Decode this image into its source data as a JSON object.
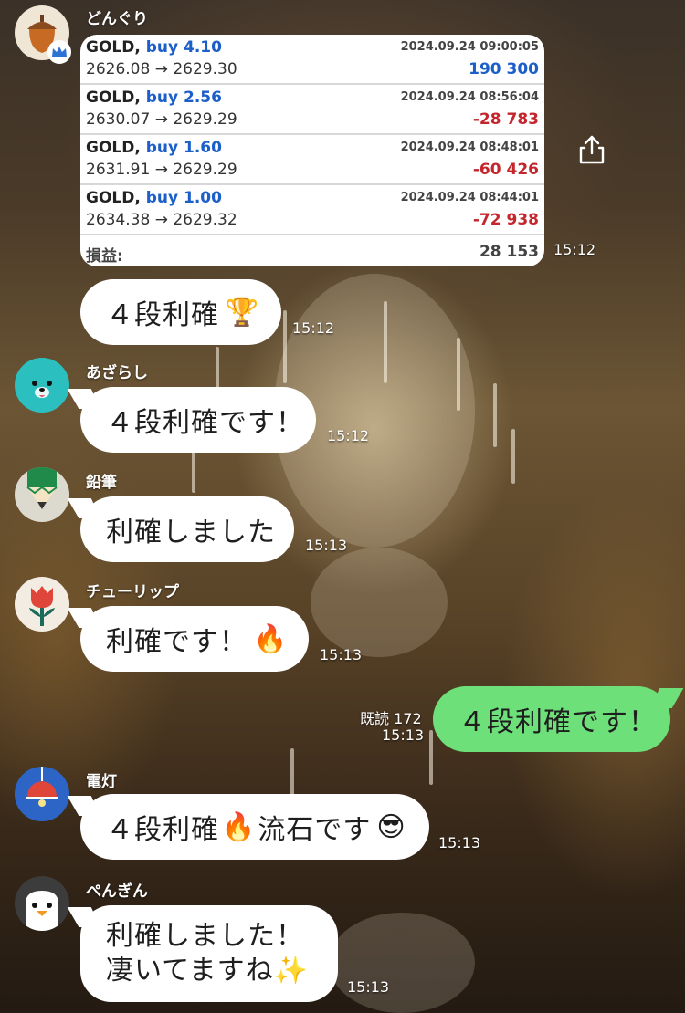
{
  "chat": {
    "trade_card": {
      "rows": [
        {
          "symbol": "GOLD,",
          "side": "buy 4.10",
          "prices": "2626.08 → 2629.30",
          "datetime": "2024.09.24 09:00:05",
          "pl": "190 300",
          "pl_sign": "pos"
        },
        {
          "symbol": "GOLD,",
          "side": "buy 2.56",
          "prices": "2630.07 → 2629.29",
          "datetime": "2024.09.24 08:56:04",
          "pl": "-28 783",
          "pl_sign": "neg"
        },
        {
          "symbol": "GOLD,",
          "side": "buy 1.60",
          "prices": "2631.91 → 2629.29",
          "datetime": "2024.09.24 08:48:01",
          "pl": "-60 426",
          "pl_sign": "neg"
        },
        {
          "symbol": "GOLD,",
          "side": "buy 1.00",
          "prices": "2634.38 → 2629.32",
          "datetime": "2024.09.24 08:44:01",
          "pl": "-72 938",
          "pl_sign": "neg"
        }
      ],
      "total_label": "損益:",
      "total_value": "28 153"
    },
    "messages": [
      {
        "sender": "どんぐり",
        "time_card": "15:12",
        "text": "４段利確",
        "emoji": "🏆",
        "time": "15:12"
      },
      {
        "sender": "あざらし",
        "text": "４段利確です！",
        "time": "15:12"
      },
      {
        "sender": "鉛筆",
        "text": "利確しました",
        "time": "15:13"
      },
      {
        "sender": "チューリップ",
        "text": "利確です！",
        "emoji": "🔥",
        "time": "15:13"
      },
      {
        "own": true,
        "read_label": "既読 172",
        "text": "４段利確です！",
        "time": "15:13"
      },
      {
        "sender": "電灯",
        "text": "４段利確",
        "emoji": "🔥",
        "text2": "流石です",
        "emoji2": "😎",
        "time": "15:13"
      },
      {
        "sender": "ぺんぎん",
        "line1": "利確しました！",
        "line2": "凄いてますね",
        "emoji": "✨",
        "time": "15:13"
      }
    ]
  },
  "icons": {
    "share": "share-icon",
    "avatars": [
      "acorn-icon",
      "seal-icon",
      "pencil-icon",
      "tulip-icon",
      "lamp-icon",
      "penguin-icon"
    ],
    "badge": "crown-badge-icon"
  },
  "colors": {
    "own_bubble": "#6ee07a",
    "profit": "#1d5fc9",
    "loss": "#c4262e"
  }
}
